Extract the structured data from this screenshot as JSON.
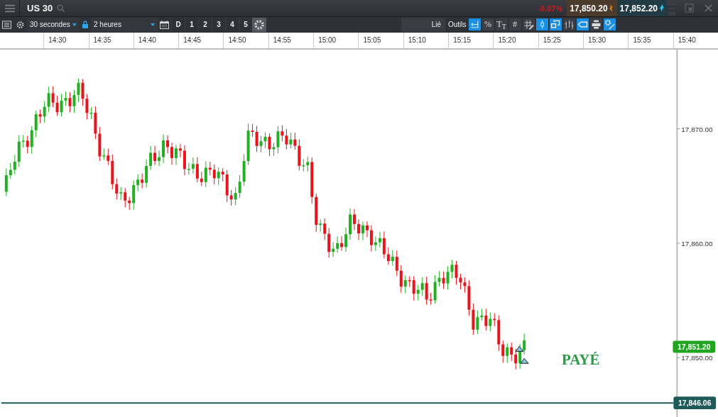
{
  "instrument": {
    "symbol": "US 30"
  },
  "quote": {
    "change": "-0.07%",
    "bid": "17,850.20",
    "ask": "17,852.20"
  },
  "toolbar": {
    "interval": "30 secondes",
    "range": "2 heures",
    "range_locked": true,
    "period_buttons": [
      {
        "label": "D",
        "selected": false
      },
      {
        "label": "1",
        "selected": false
      },
      {
        "label": "2",
        "selected": false
      },
      {
        "label": "3",
        "selected": false
      },
      {
        "label": "4",
        "selected": false
      },
      {
        "label": "5",
        "selected": false
      }
    ],
    "linked_label": "Lié",
    "tools_label": "Outils",
    "tools": [
      {
        "kind": "scale",
        "selected": true
      },
      {
        "kind": "text",
        "label": "%",
        "selected": false
      },
      {
        "kind": "text",
        "label": "T$_{T}$",
        "selected": false
      },
      {
        "kind": "text",
        "label": "#",
        "selected": false
      },
      {
        "kind": "grid-pencil",
        "selected": false
      },
      {
        "kind": "candle",
        "selected": true
      },
      {
        "kind": "windows",
        "selected": true
      },
      {
        "kind": "bars",
        "selected": false
      },
      {
        "kind": "tag",
        "selected": true
      },
      {
        "kind": "printer",
        "selected": false
      },
      {
        "kind": "gear-pencil",
        "selected": true
      }
    ]
  },
  "time_axis": [
    "14:30",
    "14:35",
    "14:40",
    "14:45",
    "14:50",
    "14:55",
    "15:00",
    "15:05",
    "15:10",
    "15:15",
    "15:20",
    "15:25",
    "15:30",
    "15:35",
    "15:40"
  ],
  "price_axis": [
    "17,870.00",
    "17,860.00",
    "17,850.00"
  ],
  "current_price": "17,851.20",
  "reference_price": "17,846.06",
  "annotation": "PAYÉ"
}
